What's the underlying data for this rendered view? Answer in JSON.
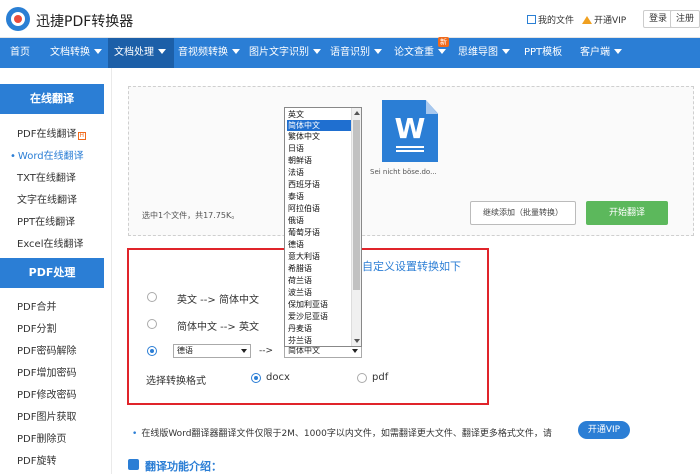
{
  "header": {
    "brand": "迅捷PDF转换器",
    "my_files": "我的文件",
    "open_vip": "开通VIP",
    "login": "登录",
    "register": "注册"
  },
  "nav": {
    "items": [
      "首页",
      "文档转换",
      "文档处理",
      "音视频转换",
      "图片文字识别",
      "语音识别",
      "论文查重",
      "思维导图",
      "PPT模板",
      "客户端"
    ],
    "new_badge": "新"
  },
  "sidebar": {
    "section1": "在线翻译",
    "items1": [
      "PDF在线翻译",
      "Word在线翻译",
      "TXT在线翻译",
      "文字在线翻译",
      "PPT在线翻译",
      "Excel在线翻译"
    ],
    "hot_badge": "H",
    "section2": "PDF处理",
    "items2": [
      "PDF合并",
      "PDF分割",
      "PDF密码解除",
      "PDF增加密码",
      "PDF修改密码",
      "PDF图片获取",
      "PDF删除页",
      "PDF旋转"
    ]
  },
  "upload": {
    "file_name": "Sei nicht böse.do...",
    "file_info": "选中1个文件，共17.75K。",
    "continue_btn": "继续添加（批量转换）",
    "start_btn": "开始翻译"
  },
  "options": {
    "title": "自定义设置转换如下",
    "opt1": "英文 --> 简体中文",
    "opt2": "简体中文 --> 英文",
    "source_select": "德语",
    "arrow": "-->",
    "target_select": "简体中文",
    "format_label": "选择转换格式",
    "format_docx": "docx",
    "format_pdf": "pdf"
  },
  "dropdown": {
    "items": [
      "英文",
      "简体中文",
      "繁体中文",
      "日语",
      "朝鲜语",
      "法语",
      "西班牙语",
      "泰语",
      "阿拉伯语",
      "俄语",
      "葡萄牙语",
      "德语",
      "意大利语",
      "希腊语",
      "荷兰语",
      "波兰语",
      "保加利亚语",
      "爱沙尼亚语",
      "丹麦语",
      "芬兰语"
    ],
    "highlighted": "简体中文"
  },
  "footer": {
    "notice": "在线版Word翻译器翻译文件仅限于2M、1000字以内文件，如需翻译更大文件、翻译更多格式文件，请",
    "vip_btn": "开通VIP",
    "intro": "翻译功能介绍："
  }
}
